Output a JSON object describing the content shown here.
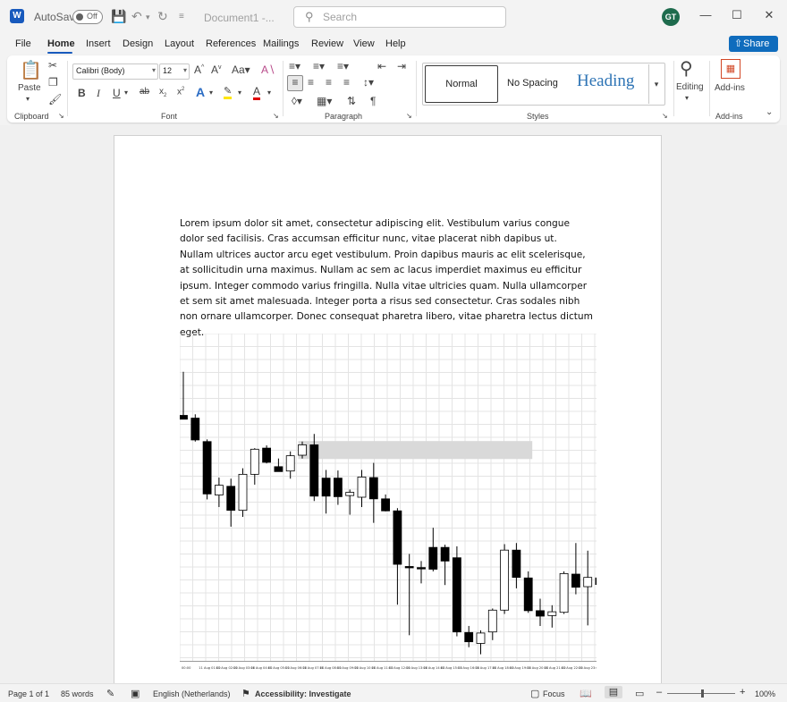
{
  "titlebar": {
    "app_logo": "W",
    "autosave_label": "AutoSave",
    "autosave_state": "Off",
    "document_title": "Document1 -...",
    "search_placeholder": "Search",
    "user_initials": "GT"
  },
  "menu": {
    "items": [
      "File",
      "Home",
      "Insert",
      "Design",
      "Layout",
      "References",
      "Mailings",
      "Review",
      "View",
      "Help"
    ],
    "active": "Home",
    "share_label": "Share"
  },
  "ribbon": {
    "clipboard": {
      "label": "Clipboard",
      "paste_label": "Paste"
    },
    "font": {
      "label": "Font",
      "font_name": "Calibri (Body)",
      "font_size": "12"
    },
    "paragraph": {
      "label": "Paragraph"
    },
    "styles": {
      "label": "Styles",
      "normal": "Normal",
      "no_spacing": "No Spacing",
      "heading": "Heading"
    },
    "editing": {
      "label": "Editing"
    },
    "addins": {
      "label": "Add-ins",
      "group_label": "Add-ins"
    }
  },
  "document": {
    "paragraph": "Lorem ipsum dolor sit amet, consectetur adipiscing elit. Vestibulum varius congue dolor sed facilisis. Cras accumsan efficitur nunc, vitae placerat nibh dapibus ut. Nullam ultrices auctor arcu eget vestibulum. Proin dapibus mauris ac elit scelerisque, at sollicitudin urna maximus. Nullam ac sem ac lacus imperdiet maximus eu efficitur ipsum. Integer commodo varius fringilla. Nulla vitae ultricies quam. Nulla ullamcorper et sem sit amet malesuada. Integer porta a risus sed consectetur. Cras sodales nibh non ornare ullamcorper. Donec consequat pharetra libero, vitae pharetra lectus dictum eget."
  },
  "chart_data": {
    "type": "candlestick",
    "x_tick_labels": [
      "00:00",
      "11 Aug 01:00",
      "11 Aug 02:00",
      "11 Aug 03:00",
      "11 Aug 04:00",
      "11 Aug 05:00",
      "11 Aug 06:00",
      "11 Aug 07:00",
      "11 Aug 08:00",
      "11 Aug 09:00",
      "11 Aug 10:00",
      "11 Aug 11:00",
      "11 Aug 12:00",
      "11 Aug 13:00",
      "11 Aug 14:00",
      "11 Aug 15:00",
      "11 Aug 16:00",
      "11 Aug 17:00",
      "11 Aug 18:00",
      "11 Aug 19:00",
      "11 Aug 20:00",
      "11 Aug 21:00",
      "11 Aug 22:00",
      "11 Aug 23:00"
    ],
    "candles": [
      {
        "o": 75.0,
        "h": 83.0,
        "l": 74.5,
        "c": 74.3
      },
      {
        "o": 74.5,
        "h": 75.2,
        "l": 70.2,
        "c": 70.5
      },
      {
        "o": 70.2,
        "h": 70.6,
        "l": 59.6,
        "c": 60.6
      },
      {
        "o": 60.4,
        "h": 63.6,
        "l": 58.2,
        "c": 62.2
      },
      {
        "o": 62.0,
        "h": 63.4,
        "l": 54.6,
        "c": 57.6
      },
      {
        "o": 57.6,
        "h": 65.3,
        "l": 56.4,
        "c": 64.2
      },
      {
        "o": 64.2,
        "h": 69.0,
        "l": 62.3,
        "c": 68.8
      },
      {
        "o": 69.0,
        "h": 69.5,
        "l": 66.2,
        "c": 66.4
      },
      {
        "o": 65.6,
        "h": 67.1,
        "l": 64.9,
        "c": 64.7
      },
      {
        "o": 64.8,
        "h": 68.4,
        "l": 63.4,
        "c": 67.6
      },
      {
        "o": 67.7,
        "h": 70.2,
        "l": 67.1,
        "c": 69.6
      },
      {
        "o": 69.6,
        "h": 71.6,
        "l": 59.3,
        "c": 60.2
      },
      {
        "o": 63.5,
        "h": 65.0,
        "l": 57.0,
        "c": 60.2
      },
      {
        "o": 63.5,
        "h": 64.9,
        "l": 58.6,
        "c": 60.1
      },
      {
        "o": 60.3,
        "h": 61.4,
        "l": 56.8,
        "c": 60.9
      },
      {
        "o": 60.0,
        "h": 65.0,
        "l": 58.2,
        "c": 63.7
      },
      {
        "o": 63.6,
        "h": 66.3,
        "l": 55.3,
        "c": 59.7
      },
      {
        "o": 59.7,
        "h": 60.5,
        "l": 57.4,
        "c": 57.5
      },
      {
        "o": 57.5,
        "h": 58.0,
        "l": 40.3,
        "c": 47.7
      },
      {
        "o": 47.3,
        "h": 49.6,
        "l": 34.7,
        "c": 47.1
      },
      {
        "o": 47.1,
        "h": 48.3,
        "l": 44.2,
        "c": 47.0
      },
      {
        "o": 50.8,
        "h": 54.4,
        "l": 46.4,
        "c": 46.8
      },
      {
        "o": 50.8,
        "h": 51.3,
        "l": 43.9,
        "c": 48.3
      },
      {
        "o": 48.9,
        "h": 51.0,
        "l": 34.5,
        "c": 35.3
      },
      {
        "o": 35.2,
        "h": 36.4,
        "l": 32.5,
        "c": 33.5
      },
      {
        "o": 33.2,
        "h": 35.6,
        "l": 31.2,
        "c": 35.1
      },
      {
        "o": 35.3,
        "h": 39.6,
        "l": 33.8,
        "c": 39.3
      },
      {
        "o": 39.3,
        "h": 51.4,
        "l": 38.6,
        "c": 50.3
      },
      {
        "o": 50.3,
        "h": 51.6,
        "l": 43.3,
        "c": 45.3
      },
      {
        "o": 45.2,
        "h": 46.4,
        "l": 38.8,
        "c": 39.2
      },
      {
        "o": 39.2,
        "h": 41.4,
        "l": 36.4,
        "c": 38.2
      },
      {
        "o": 38.3,
        "h": 40.2,
        "l": 36.1,
        "c": 39.0
      },
      {
        "o": 38.9,
        "h": 46.4,
        "l": 38.6,
        "c": 46.0
      },
      {
        "o": 45.9,
        "h": 51.6,
        "l": 42.2,
        "c": 43.5
      },
      {
        "o": 43.6,
        "h": 50.2,
        "l": 36.5,
        "c": 45.3
      },
      {
        "o": 45.2,
        "h": 47.0,
        "l": 44.0,
        "c": 44.0
      }
    ],
    "highlight_zone": {
      "x_from_candle": 10,
      "x_to_candle": 29,
      "y_from": 67.0,
      "y_to": 70.3,
      "color": "#d9d9d9"
    },
    "y_range": [
      30,
      90
    ],
    "grid": true,
    "colors": {
      "up_fill": "#ffffff",
      "down_fill": "#000000",
      "grid": "#e4e4e4"
    }
  },
  "status": {
    "page": "Page 1 of 1",
    "words": "85 words",
    "language": "English (Netherlands)",
    "accessibility": "Accessibility: Investigate",
    "focus": "Focus",
    "zoom": "100%",
    "zoom_level": 1.0
  }
}
